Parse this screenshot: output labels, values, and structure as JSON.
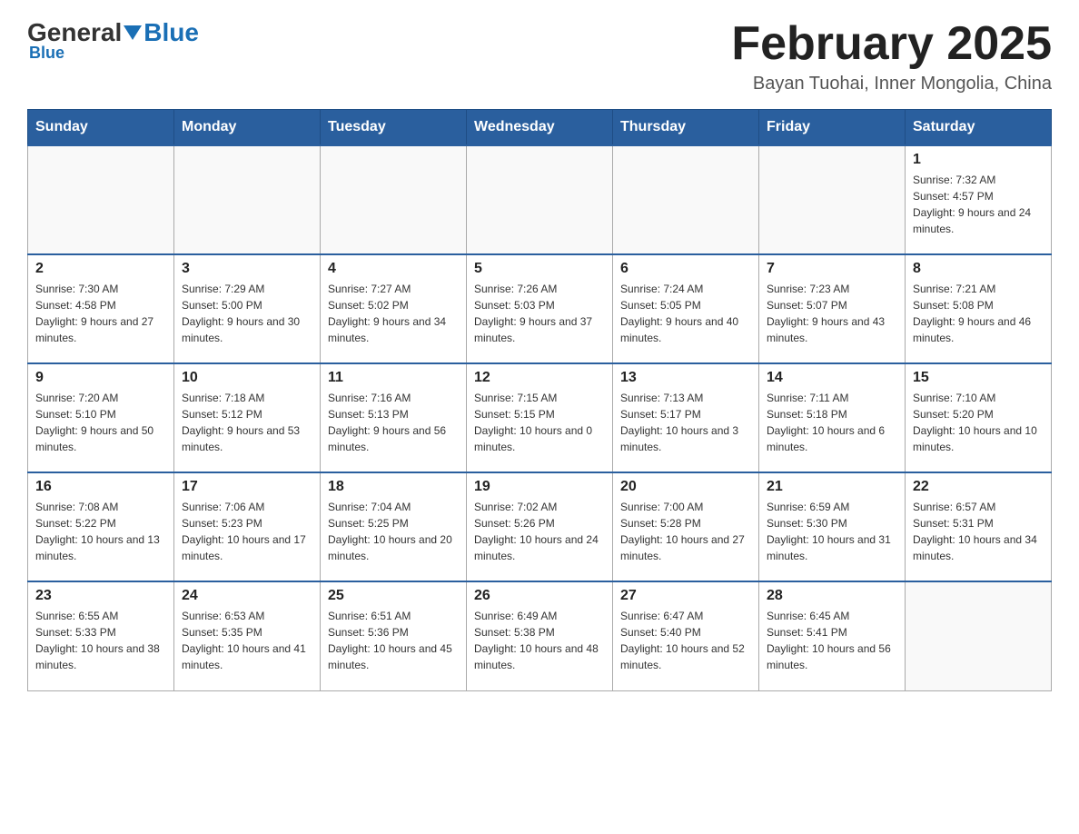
{
  "header": {
    "logo_general": "General",
    "logo_blue": "Blue",
    "month_title": "February 2025",
    "location": "Bayan Tuohai, Inner Mongolia, China"
  },
  "days_of_week": [
    "Sunday",
    "Monday",
    "Tuesday",
    "Wednesday",
    "Thursday",
    "Friday",
    "Saturday"
  ],
  "weeks": [
    {
      "days": [
        {
          "number": "",
          "info": ""
        },
        {
          "number": "",
          "info": ""
        },
        {
          "number": "",
          "info": ""
        },
        {
          "number": "",
          "info": ""
        },
        {
          "number": "",
          "info": ""
        },
        {
          "number": "",
          "info": ""
        },
        {
          "number": "1",
          "info": "Sunrise: 7:32 AM\nSunset: 4:57 PM\nDaylight: 9 hours and 24 minutes."
        }
      ]
    },
    {
      "days": [
        {
          "number": "2",
          "info": "Sunrise: 7:30 AM\nSunset: 4:58 PM\nDaylight: 9 hours and 27 minutes."
        },
        {
          "number": "3",
          "info": "Sunrise: 7:29 AM\nSunset: 5:00 PM\nDaylight: 9 hours and 30 minutes."
        },
        {
          "number": "4",
          "info": "Sunrise: 7:27 AM\nSunset: 5:02 PM\nDaylight: 9 hours and 34 minutes."
        },
        {
          "number": "5",
          "info": "Sunrise: 7:26 AM\nSunset: 5:03 PM\nDaylight: 9 hours and 37 minutes."
        },
        {
          "number": "6",
          "info": "Sunrise: 7:24 AM\nSunset: 5:05 PM\nDaylight: 9 hours and 40 minutes."
        },
        {
          "number": "7",
          "info": "Sunrise: 7:23 AM\nSunset: 5:07 PM\nDaylight: 9 hours and 43 minutes."
        },
        {
          "number": "8",
          "info": "Sunrise: 7:21 AM\nSunset: 5:08 PM\nDaylight: 9 hours and 46 minutes."
        }
      ]
    },
    {
      "days": [
        {
          "number": "9",
          "info": "Sunrise: 7:20 AM\nSunset: 5:10 PM\nDaylight: 9 hours and 50 minutes."
        },
        {
          "number": "10",
          "info": "Sunrise: 7:18 AM\nSunset: 5:12 PM\nDaylight: 9 hours and 53 minutes."
        },
        {
          "number": "11",
          "info": "Sunrise: 7:16 AM\nSunset: 5:13 PM\nDaylight: 9 hours and 56 minutes."
        },
        {
          "number": "12",
          "info": "Sunrise: 7:15 AM\nSunset: 5:15 PM\nDaylight: 10 hours and 0 minutes."
        },
        {
          "number": "13",
          "info": "Sunrise: 7:13 AM\nSunset: 5:17 PM\nDaylight: 10 hours and 3 minutes."
        },
        {
          "number": "14",
          "info": "Sunrise: 7:11 AM\nSunset: 5:18 PM\nDaylight: 10 hours and 6 minutes."
        },
        {
          "number": "15",
          "info": "Sunrise: 7:10 AM\nSunset: 5:20 PM\nDaylight: 10 hours and 10 minutes."
        }
      ]
    },
    {
      "days": [
        {
          "number": "16",
          "info": "Sunrise: 7:08 AM\nSunset: 5:22 PM\nDaylight: 10 hours and 13 minutes."
        },
        {
          "number": "17",
          "info": "Sunrise: 7:06 AM\nSunset: 5:23 PM\nDaylight: 10 hours and 17 minutes."
        },
        {
          "number": "18",
          "info": "Sunrise: 7:04 AM\nSunset: 5:25 PM\nDaylight: 10 hours and 20 minutes."
        },
        {
          "number": "19",
          "info": "Sunrise: 7:02 AM\nSunset: 5:26 PM\nDaylight: 10 hours and 24 minutes."
        },
        {
          "number": "20",
          "info": "Sunrise: 7:00 AM\nSunset: 5:28 PM\nDaylight: 10 hours and 27 minutes."
        },
        {
          "number": "21",
          "info": "Sunrise: 6:59 AM\nSunset: 5:30 PM\nDaylight: 10 hours and 31 minutes."
        },
        {
          "number": "22",
          "info": "Sunrise: 6:57 AM\nSunset: 5:31 PM\nDaylight: 10 hours and 34 minutes."
        }
      ]
    },
    {
      "days": [
        {
          "number": "23",
          "info": "Sunrise: 6:55 AM\nSunset: 5:33 PM\nDaylight: 10 hours and 38 minutes."
        },
        {
          "number": "24",
          "info": "Sunrise: 6:53 AM\nSunset: 5:35 PM\nDaylight: 10 hours and 41 minutes."
        },
        {
          "number": "25",
          "info": "Sunrise: 6:51 AM\nSunset: 5:36 PM\nDaylight: 10 hours and 45 minutes."
        },
        {
          "number": "26",
          "info": "Sunrise: 6:49 AM\nSunset: 5:38 PM\nDaylight: 10 hours and 48 minutes."
        },
        {
          "number": "27",
          "info": "Sunrise: 6:47 AM\nSunset: 5:40 PM\nDaylight: 10 hours and 52 minutes."
        },
        {
          "number": "28",
          "info": "Sunrise: 6:45 AM\nSunset: 5:41 PM\nDaylight: 10 hours and 56 minutes."
        },
        {
          "number": "",
          "info": ""
        }
      ]
    }
  ]
}
